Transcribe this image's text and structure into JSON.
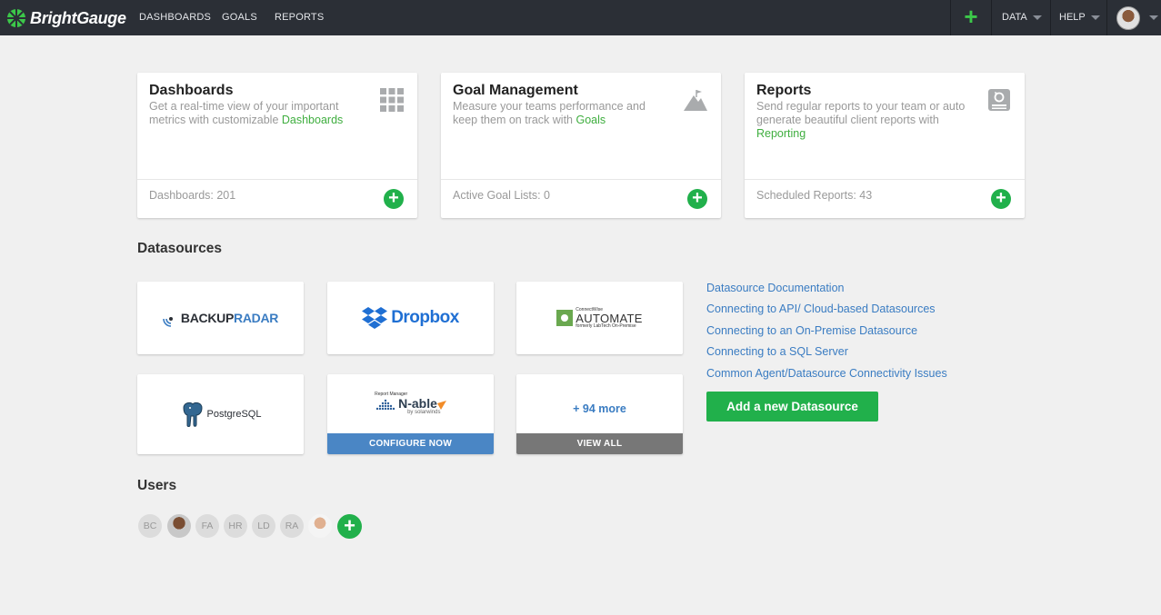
{
  "brand": {
    "name": "BrightGauge",
    "accent": "#21b04b"
  },
  "nav": {
    "links": [
      "DASHBOARDS",
      "GOALS",
      "REPORTS"
    ],
    "data_label": "DATA",
    "help_label": "HELP"
  },
  "cards": [
    {
      "title": "Dashboards",
      "desc": "Get a real-time view of your important metrics with customizable ",
      "link": "Dashboards",
      "count": "Dashboards: 201",
      "icon": "grid-icon"
    },
    {
      "title": "Goal Management",
      "desc": "Measure your teams performance and keep them on track with ",
      "link": "Goals",
      "count": "Active Goal Lists: 0",
      "icon": "mountain-flag-icon"
    },
    {
      "title": "Reports",
      "desc": "Send regular reports to your team or auto generate beautiful client reports with ",
      "link": "Reporting",
      "count": "Scheduled Reports: 43",
      "icon": "report-icon"
    }
  ],
  "datasources": {
    "heading": "Datasources",
    "tiles": [
      {
        "name": "BACKUPRADAR",
        "name_a": "BACKUP",
        "name_b": "RADAR"
      },
      {
        "name": "Dropbox"
      },
      {
        "name": "AUTOMATE",
        "small_top": "ConnectWise",
        "small_bottom": "formerly LabTech On-Premise"
      },
      {
        "name": "PostgreSQL"
      },
      {
        "name": "N-able",
        "small_top": "Report Manager",
        "small_bottom": "by solarwinds",
        "bar": "CONFIGURE NOW"
      },
      {
        "name": "+ 94 more",
        "bar": "VIEW ALL"
      }
    ],
    "docs": [
      "Datasource Documentation",
      "Connecting to API/ Cloud-based Datasources",
      "Connecting to an On-Premise Datasource",
      "Connecting to a SQL Server",
      "Common Agent/Datasource Connectivity Issues"
    ],
    "add_button": "Add a new Datasource"
  },
  "users": {
    "heading": "Users",
    "list": [
      "BC",
      "",
      "FA",
      "HR",
      "LD",
      "RA",
      ""
    ]
  }
}
